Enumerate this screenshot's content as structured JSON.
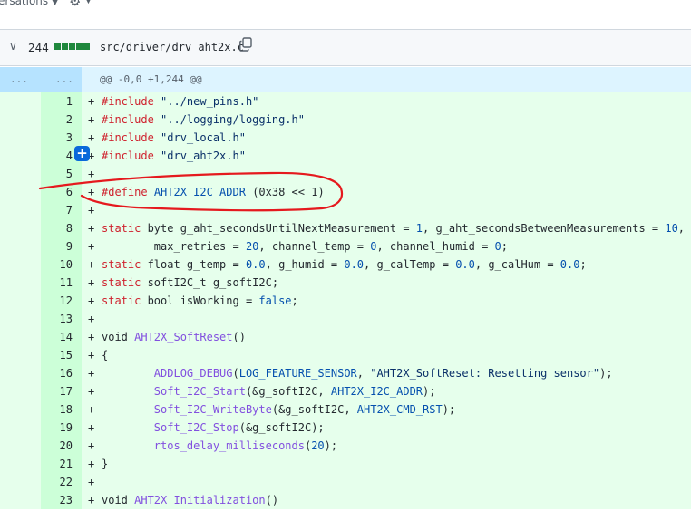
{
  "topbar": {
    "conversations_label": "ersations"
  },
  "file": {
    "change_count": "244",
    "path": "src/driver/drv_aht2x.c",
    "diffstat_blocks": 5
  },
  "hunk": {
    "left_dots": "...",
    "right_dots": "...",
    "header": "@@ -0,0 +1,244 @@"
  },
  "lines": [
    {
      "n": "1",
      "html": "<span class='kw'>#include</span> <span class='st'>\"../new_pins.h\"</span>"
    },
    {
      "n": "2",
      "html": "<span class='kw'>#include</span> <span class='st'>\"../logging/logging.h\"</span>"
    },
    {
      "n": "3",
      "html": "<span class='kw'>#include</span> <span class='st'>\"drv_local.h\"</span>"
    },
    {
      "n": "4",
      "html": "<span class='kw'>#include</span> <span class='st'>\"drv_aht2x.h\"</span>"
    },
    {
      "n": "5",
      "html": ""
    },
    {
      "n": "6",
      "html": "<span class='kw'>#define</span> <span class='nm'>AHT2X_I2C_ADDR</span> (0x38 &lt;&lt; 1)"
    },
    {
      "n": "7",
      "html": ""
    },
    {
      "n": "8",
      "html": "<span class='kw'>static</span> byte g_aht_secondsUntilNextMeasurement = <span class='nm'>1</span>, g_aht_secondsBetweenMeasurements = <span class='nm'>10</span>,"
    },
    {
      "n": "9",
      "html": "        max_retries = <span class='nm'>20</span>, channel_temp = <span class='nm'>0</span>, channel_humid = <span class='nm'>0</span>;"
    },
    {
      "n": "10",
      "html": "<span class='kw'>static</span> float g_temp = <span class='nm'>0.0</span>, g_humid = <span class='nm'>0.0</span>, g_calTemp = <span class='nm'>0.0</span>, g_calHum = <span class='nm'>0.0</span>;"
    },
    {
      "n": "11",
      "html": "<span class='kw'>static</span> softI2C_t g_softI2C;"
    },
    {
      "n": "12",
      "html": "<span class='kw'>static</span> bool isWorking = <span class='nm'>false</span>;"
    },
    {
      "n": "13",
      "html": ""
    },
    {
      "n": "14",
      "html": "void <span class='fn'>AHT2X_SoftReset</span>()"
    },
    {
      "n": "15",
      "html": "{"
    },
    {
      "n": "16",
      "html": "        <span class='fn'>ADDLOG_DEBUG</span>(<span class='nm'>LOG_FEATURE_SENSOR</span>, <span class='st'>\"AHT2X_SoftReset: Resetting sensor\"</span>);"
    },
    {
      "n": "17",
      "html": "        <span class='fn'>Soft_I2C_Start</span>(&amp;g_softI2C, <span class='nm'>AHT2X_I2C_ADDR</span>);"
    },
    {
      "n": "18",
      "html": "        <span class='fn'>Soft_I2C_WriteByte</span>(&amp;g_softI2C, <span class='nm'>AHT2X_CMD_RST</span>);"
    },
    {
      "n": "19",
      "html": "        <span class='fn'>Soft_I2C_Stop</span>(&amp;g_softI2C);"
    },
    {
      "n": "20",
      "html": "        <span class='fn'>rtos_delay_milliseconds</span>(<span class='nm'>20</span>);"
    },
    {
      "n": "21",
      "html": "}"
    },
    {
      "n": "22",
      "html": ""
    },
    {
      "n": "23",
      "html": "void <span class='fn'>AHT2X_Initialization</span>()"
    }
  ],
  "colors": {
    "added_bg": "#e6ffec",
    "added_gutter": "#ccffd8",
    "hunk_bg": "#ddf4ff",
    "annotation": "#e5191e",
    "accent": "#0969da"
  }
}
